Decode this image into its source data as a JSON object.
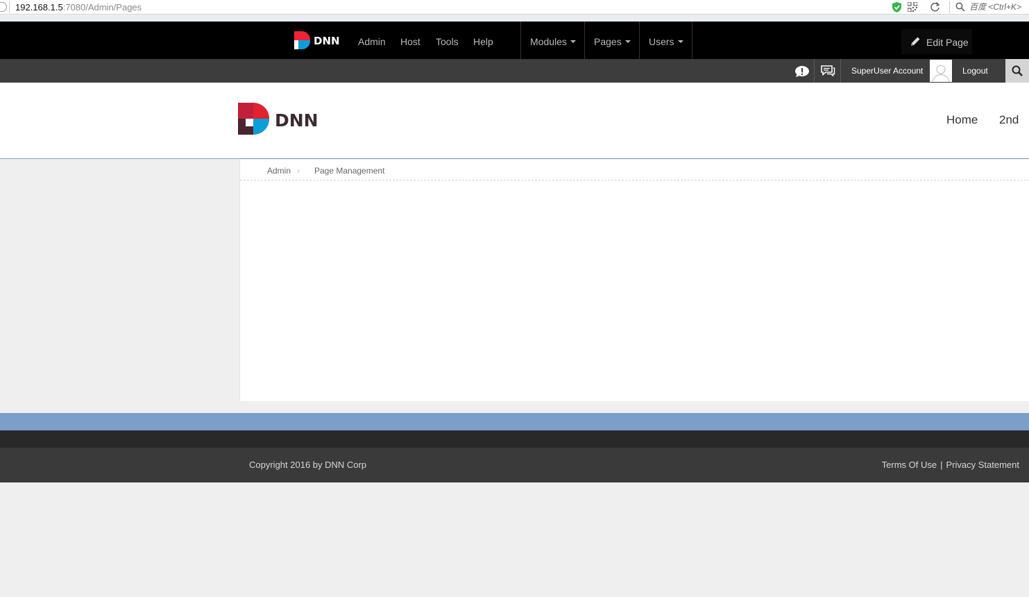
{
  "browser": {
    "url_host": "192.168.1.5",
    "url_rest": ":7080/Admin/Pages",
    "search_placeholder": "百度 <Ctrl+K>"
  },
  "topnav": {
    "logo_text": "DNN",
    "items": [
      {
        "label": "Admin"
      },
      {
        "label": "Host"
      },
      {
        "label": "Tools"
      },
      {
        "label": "Help"
      }
    ],
    "dropdowns": [
      {
        "label": "Modules"
      },
      {
        "label": "Pages"
      },
      {
        "label": "Users"
      }
    ],
    "edit_page_label": "Edit Page"
  },
  "controlbar": {
    "user_name": "SuperUser Account",
    "logout_label": "Logout"
  },
  "header": {
    "logo_text": "DNN",
    "menu": [
      {
        "label": "Home"
      },
      {
        "label": "2nd"
      }
    ]
  },
  "breadcrumb": {
    "items": [
      {
        "label": "Admin"
      },
      {
        "label": "Page Management"
      }
    ]
  },
  "footer": {
    "copyright": "Copyright 2016 by DNN Corp",
    "terms": "Terms Of Use",
    "separator": "|",
    "privacy": "Privacy Statement"
  }
}
